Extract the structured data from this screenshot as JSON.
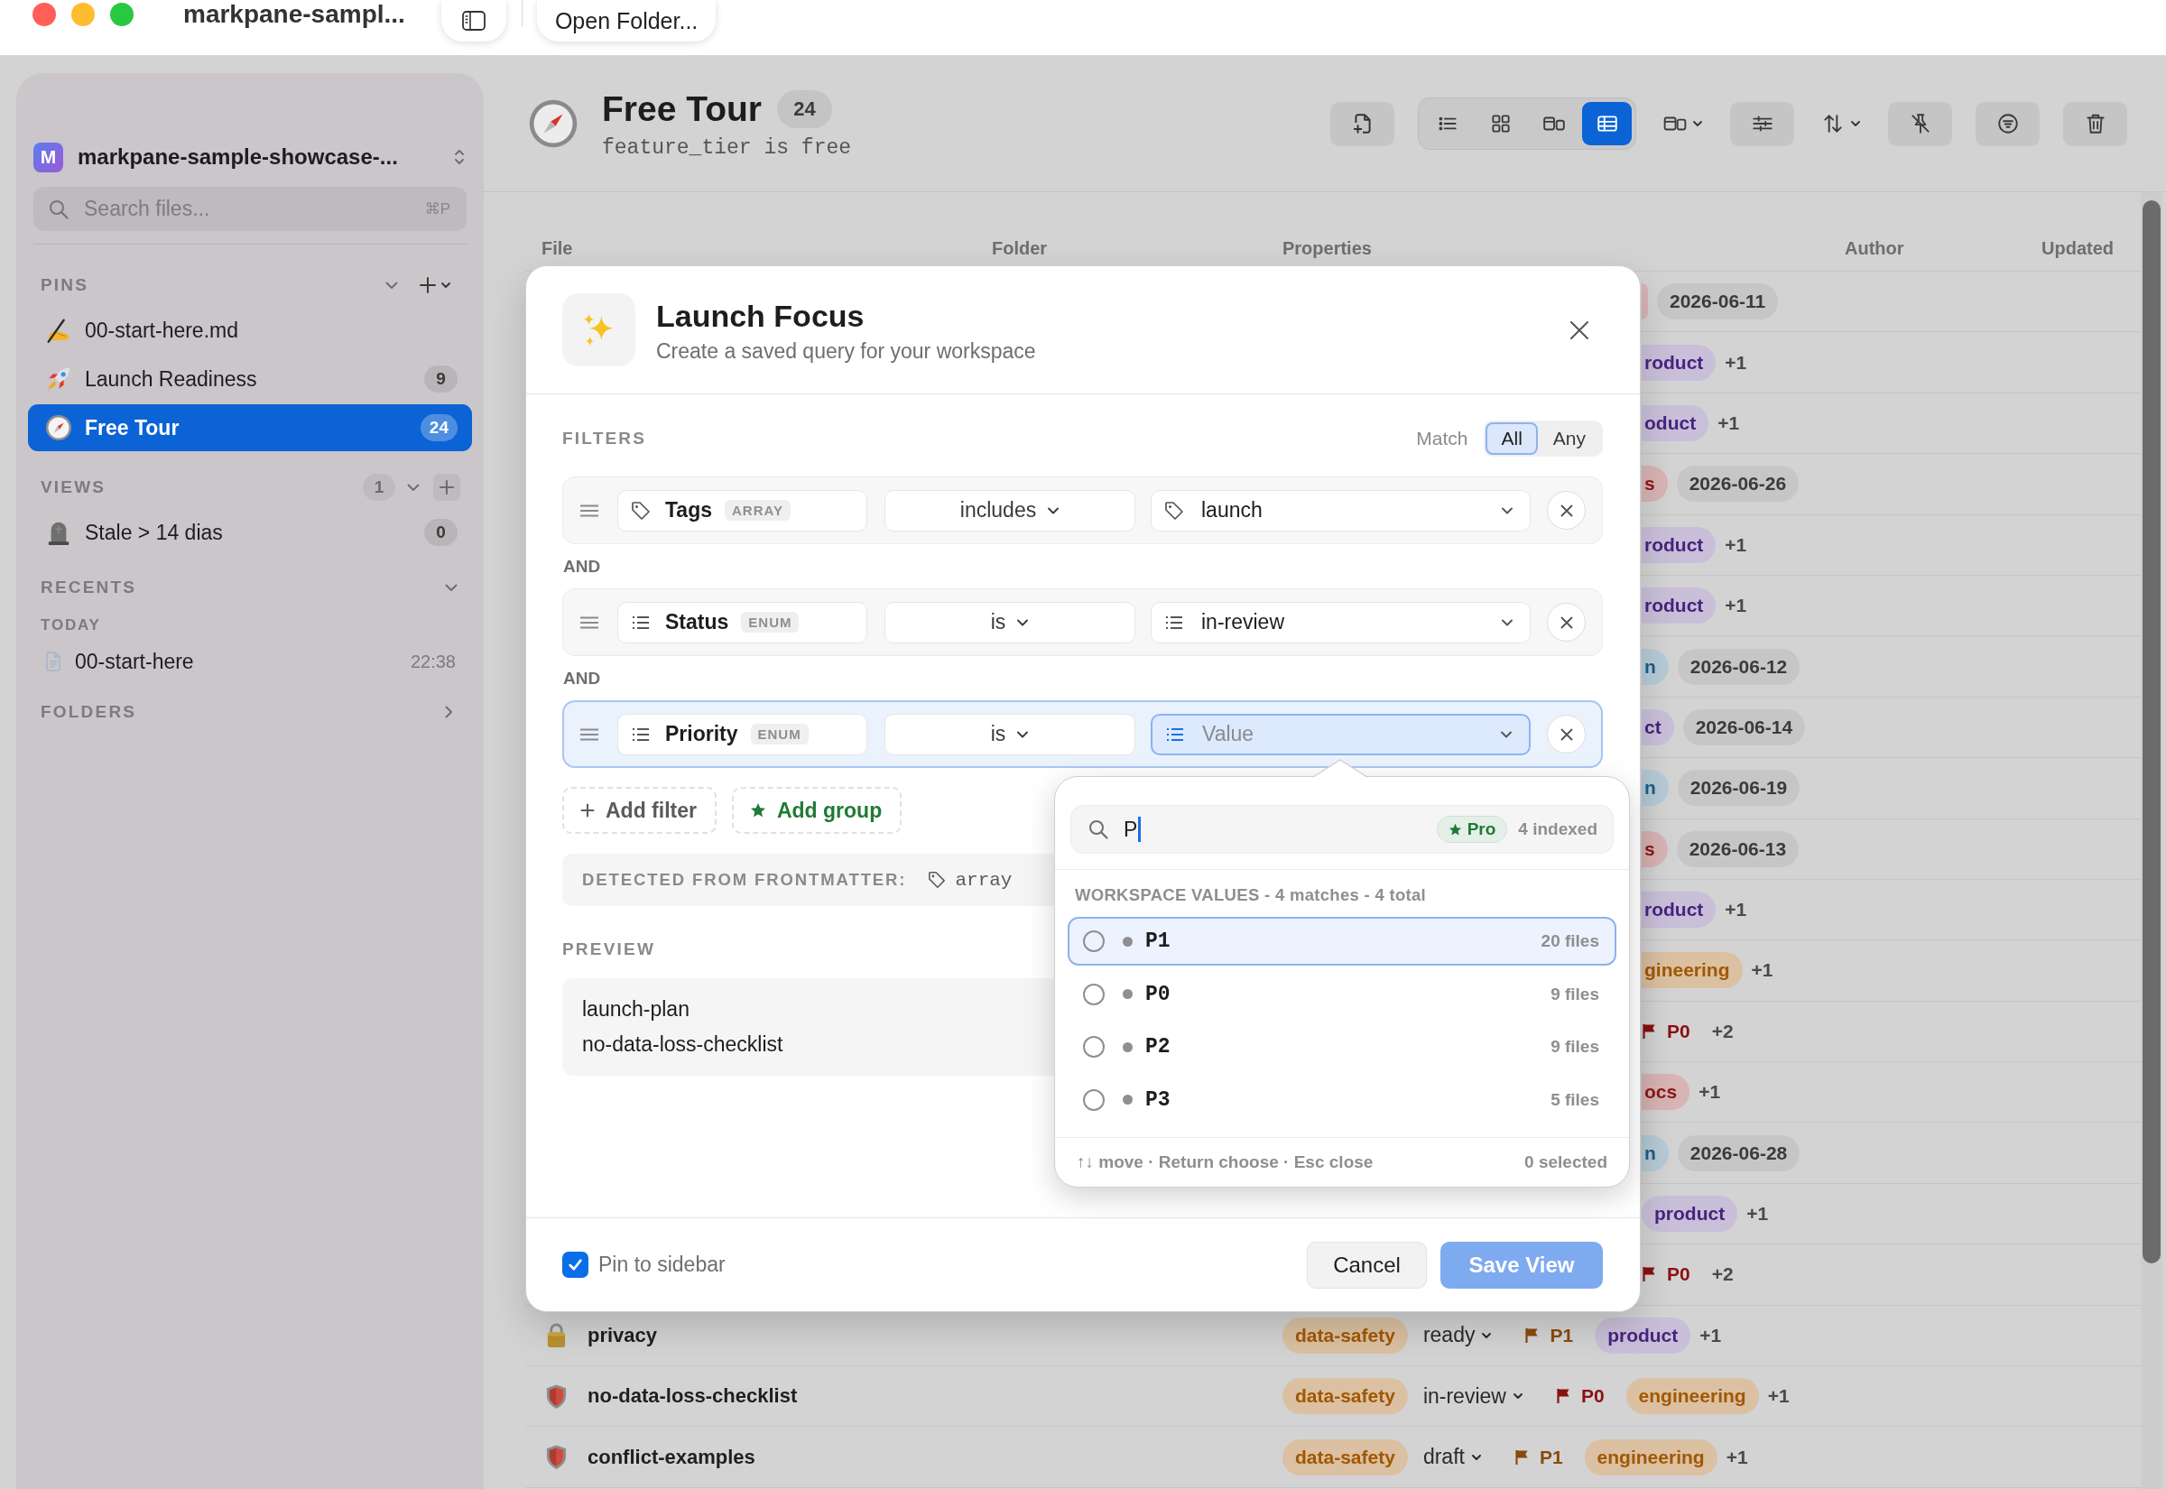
{
  "window": {
    "title": "markpane-sampl...",
    "open_folder": "Open Folder..."
  },
  "sidebar": {
    "workspace": {
      "initial": "M",
      "name": "markpane-sample-showcase-..."
    },
    "search": {
      "placeholder": "Search files...",
      "shortcut": "⌘P"
    },
    "pins": {
      "title": "PINS",
      "expanded": true,
      "items": [
        {
          "label": "00-start-here.md",
          "selected": false
        },
        {
          "label": "Launch Readiness",
          "count": "9",
          "selected": false
        },
        {
          "label": "Free Tour",
          "count": "24",
          "selected": true
        }
      ]
    },
    "views": {
      "title": "VIEWS",
      "count": "1",
      "expanded": true,
      "items": [
        {
          "label": "Stale > 14 dias",
          "count": "0",
          "selected": false
        }
      ]
    },
    "recents": {
      "title": "RECENTS",
      "expanded": true,
      "groups": [
        {
          "label": "TODAY",
          "items": [
            {
              "label": "00-start-here",
              "time": "22:38"
            }
          ]
        }
      ]
    },
    "folders": {
      "title": "FOLDERS",
      "expanded": false
    }
  },
  "main": {
    "title": "Free Tour",
    "count": "24",
    "subtitle": "feature_tier is free",
    "view_modes": [
      {
        "selected": false
      },
      {
        "selected": false
      },
      {
        "selected": false
      },
      {
        "selected": true
      }
    ]
  },
  "table": {
    "columns": [
      "File",
      "Folder",
      "Properties",
      "Author",
      "Updated"
    ],
    "rows": [
      {
        "kind": "covered",
        "properties": [
          {
            "kind": "edge",
            "color": "#d8b4b4"
          },
          {
            "kind": "date",
            "text": "2026-06-11"
          }
        ]
      },
      {
        "kind": "covered",
        "properties": [
          {
            "kind": "tag",
            "text": "roduct",
            "color": "#c9bfd9",
            "clipped": true
          },
          {
            "kind": "more",
            "text": "+1"
          }
        ]
      },
      {
        "kind": "covered",
        "properties": [
          {
            "kind": "tag",
            "text": "oduct",
            "color": "#c9bfd9",
            "clipped": true
          },
          {
            "kind": "more",
            "text": "+1"
          }
        ]
      },
      {
        "kind": "covered",
        "properties": [
          {
            "kind": "tag",
            "text": "s",
            "color": "#d8b4b4",
            "clipped": true
          },
          {
            "kind": "date",
            "text": "2026-06-26"
          }
        ]
      },
      {
        "kind": "covered",
        "properties": [
          {
            "kind": "tag",
            "text": "roduct",
            "color": "#c9bfd9",
            "clipped": true
          },
          {
            "kind": "more",
            "text": "+1"
          }
        ]
      },
      {
        "kind": "covered",
        "properties": [
          {
            "kind": "tag",
            "text": "roduct",
            "color": "#c9bfd9",
            "clipped": true
          },
          {
            "kind": "more",
            "text": "+1"
          }
        ]
      },
      {
        "kind": "covered",
        "properties": [
          {
            "kind": "tag",
            "text": "n",
            "color": "#b6cbd7",
            "clipped": true
          },
          {
            "kind": "date",
            "text": "2026-06-12"
          }
        ]
      },
      {
        "kind": "covered",
        "properties": [
          {
            "kind": "tag",
            "text": "ct",
            "color": "#c9bfd9",
            "clipped": true
          },
          {
            "kind": "date",
            "text": "2026-06-14"
          }
        ]
      },
      {
        "kind": "covered",
        "properties": [
          {
            "kind": "tag",
            "text": "n",
            "color": "#b6cbd7",
            "clipped": true
          },
          {
            "kind": "date",
            "text": "2026-06-19"
          }
        ]
      },
      {
        "kind": "covered",
        "properties": [
          {
            "kind": "tag",
            "text": "s",
            "color": "#d8b4b4",
            "clipped": true
          },
          {
            "kind": "date",
            "text": "2026-06-13"
          }
        ]
      },
      {
        "kind": "covered",
        "properties": [
          {
            "kind": "tag",
            "text": "roduct",
            "color": "#c9bfd9",
            "clipped": true
          },
          {
            "kind": "more",
            "text": "+1"
          }
        ]
      },
      {
        "kind": "covered",
        "properties": [
          {
            "kind": "tag",
            "text": "gineering",
            "color": "#dbc0a1",
            "clipped": true
          },
          {
            "kind": "more",
            "text": "+1"
          }
        ]
      },
      {
        "kind": "covered",
        "properties": [
          {
            "kind": "priority",
            "text": "P0",
            "color": "#8b1010"
          },
          {
            "kind": "more",
            "text": "+2"
          }
        ]
      },
      {
        "kind": "covered",
        "properties": [
          {
            "kind": "tag",
            "text": "ocs",
            "color": "#d8b4b4",
            "clipped": true
          },
          {
            "kind": "more",
            "text": "+1"
          }
        ]
      },
      {
        "kind": "covered",
        "properties": [
          {
            "kind": "tag",
            "text": "n",
            "color": "#b6cbd7",
            "clipped": true
          },
          {
            "kind": "date",
            "text": "2026-06-28"
          }
        ]
      },
      {
        "kind": "covered",
        "properties": [
          {
            "kind": "tag",
            "text": "product",
            "color": "#c9bfd9"
          },
          {
            "kind": "more",
            "text": "+1"
          }
        ]
      },
      {
        "kind": "covered",
        "properties": [
          {
            "kind": "priority",
            "text": "P0",
            "color": "#8b1010"
          },
          {
            "kind": "more",
            "text": "+2"
          }
        ]
      },
      {
        "kind": "full",
        "file": "privacy",
        "properties": [
          {
            "kind": "tag",
            "text": "data-safety",
            "color": "#dbc0a1"
          },
          {
            "kind": "status",
            "text": "ready"
          },
          {
            "kind": "priority",
            "text": "P1",
            "color": "#8a4a0c"
          },
          {
            "kind": "tag",
            "text": "product",
            "color": "#c9bfd9"
          },
          {
            "kind": "more",
            "text": "+1"
          }
        ]
      },
      {
        "kind": "full",
        "file": "no-data-loss-checklist",
        "properties": [
          {
            "kind": "tag",
            "text": "data-safety",
            "color": "#dbc0a1"
          },
          {
            "kind": "status",
            "text": "in-review"
          },
          {
            "kind": "priority",
            "text": "P0",
            "color": "#8b1010"
          },
          {
            "kind": "tag",
            "text": "engineering",
            "color": "#dbc0a1"
          },
          {
            "kind": "more",
            "text": "+1"
          }
        ]
      },
      {
        "kind": "full",
        "file": "conflict-examples",
        "properties": [
          {
            "kind": "tag",
            "text": "data-safety",
            "color": "#dbc0a1"
          },
          {
            "kind": "status",
            "text": "draft"
          },
          {
            "kind": "priority",
            "text": "P1",
            "color": "#8a4a0c"
          },
          {
            "kind": "tag",
            "text": "engineering",
            "color": "#dbc0a1"
          },
          {
            "kind": "more",
            "text": "+1"
          }
        ]
      }
    ]
  },
  "dialog": {
    "title": "Launch Focus",
    "subtitle": "Create a saved query for your workspace",
    "filters_label": "FILTERS",
    "match": {
      "label": "Match",
      "options": [
        {
          "label": "All",
          "selected": true
        },
        {
          "label": "Any",
          "selected": false
        }
      ]
    },
    "filters": [
      {
        "kind": "array",
        "property": "Tags",
        "type": "ARRAY",
        "operator": "includes",
        "value": "launch",
        "active": false
      },
      {
        "kind": "enum",
        "joiner": "AND",
        "property": "Status",
        "type": "ENUM",
        "operator": "is",
        "value": "in-review",
        "active": false
      },
      {
        "kind": "enum",
        "joiner": "AND",
        "property": "Priority",
        "type": "ENUM",
        "operator": "is",
        "placeholder": "Value",
        "active": true
      }
    ],
    "add_filter": "Add filter",
    "add_group": "Add group",
    "detected": {
      "label": "DETECTED FROM FRONTMATTER:",
      "value": "array"
    },
    "preview": {
      "label": "PREVIEW",
      "items": [
        "launch-plan",
        "no-data-loss-checklist"
      ]
    },
    "pin_to_sidebar": {
      "label": "Pin to sidebar",
      "checked": true
    },
    "cancel": "Cancel",
    "save": {
      "label": "Save View",
      "disabled": true
    }
  },
  "value_picker": {
    "query": "P",
    "badge": "Pro",
    "indexed": "4 indexed",
    "heading": "WORKSPACE VALUES - 4 matches - 4 total",
    "options": [
      {
        "label": "P1",
        "count": "20 files",
        "color": "#8e8e93",
        "selected": false,
        "highlighted": true
      },
      {
        "label": "P0",
        "count": "9 files",
        "color": "#8e8e93",
        "selected": false,
        "highlighted": false
      },
      {
        "label": "P2",
        "count": "9 files",
        "color": "#8e8e93",
        "selected": false,
        "highlighted": false
      },
      {
        "label": "P3",
        "count": "5 files",
        "color": "#8e8e93",
        "selected": false,
        "highlighted": false
      }
    ],
    "hint": "↑↓ move · Return choose · Esc close",
    "selected_count": "0 selected"
  }
}
